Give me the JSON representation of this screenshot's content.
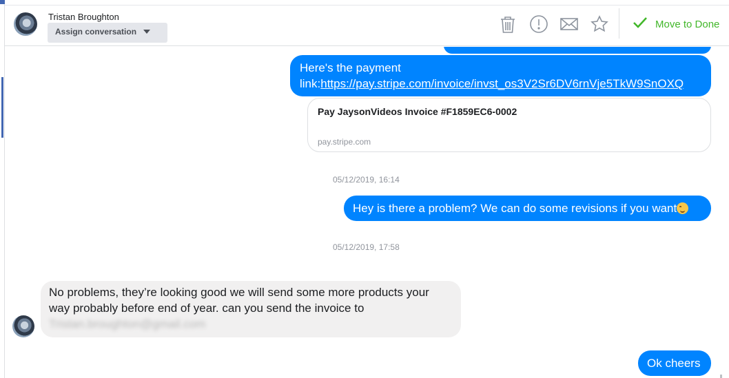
{
  "header": {
    "contact_name": "Tristan Broughton",
    "assign_label": "Assign conversation",
    "actions": {
      "delete_icon": "trash-icon",
      "spam_icon": "alert-icon",
      "unread_icon": "envelope-icon",
      "star_icon": "star-icon"
    },
    "move_to_done_label": "Move to Done"
  },
  "messages": {
    "payment_text": "Here's the payment link:",
    "payment_url": "https://pay.stripe.com/invoice/invst_os3V2Sr6DV6rnVje5TkW9SnOXQ",
    "link_card_title": "Pay JaysonVideos Invoice #F1859EC6-0002",
    "link_card_domain": "pay.stripe.com",
    "timestamp_1": "05/12/2019, 16:14",
    "problem_text": "Hey is there a problem? We can do some revisions if you want",
    "timestamp_2": "05/12/2019, 17:58",
    "reply_text": "No problems, they’re looking good we will send some more products your way probably before end of year. can you send the invoice to",
    "reply_email_blurred": "Tristan.broughton@gmail.com",
    "cheers_text": "Ok cheers"
  },
  "colors": {
    "outgoing_bubble": "#0084ff",
    "incoming_bubble": "#f1f0f0",
    "done_green": "#42b72a",
    "accent_blue": "#4267b2"
  }
}
